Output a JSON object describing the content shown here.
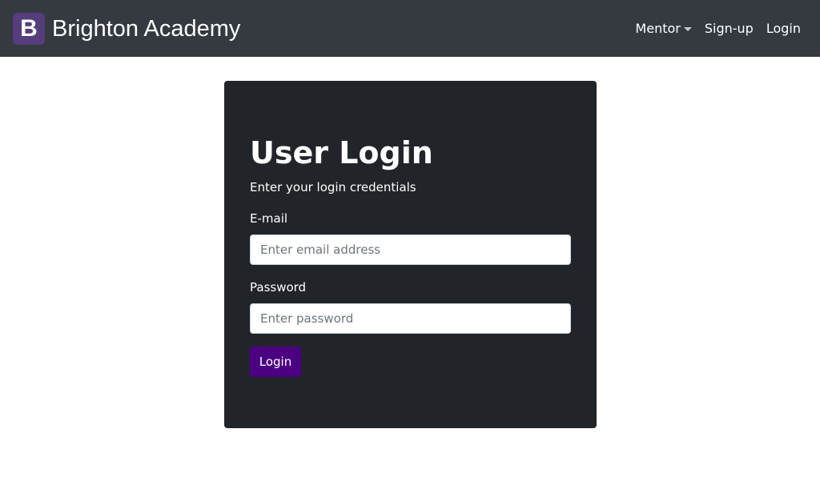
{
  "navbar": {
    "brand_logo_letter": "B",
    "brand_name": "Brighton Academy",
    "links": {
      "mentor": "Mentor",
      "signup": "Sign-up",
      "login": "Login"
    }
  },
  "login_card": {
    "title": "User Login",
    "subtitle": "Enter your login credentials",
    "email_label": "E-mail",
    "email_placeholder": "Enter email address",
    "email_value": "",
    "password_label": "Password",
    "password_placeholder": "Enter password",
    "password_value": "",
    "submit_label": "Login"
  },
  "colors": {
    "navbar_bg": "#343a40",
    "brand_logo_bg": "#563d7c",
    "card_bg": "#212529",
    "button_bg": "#4b0082"
  }
}
